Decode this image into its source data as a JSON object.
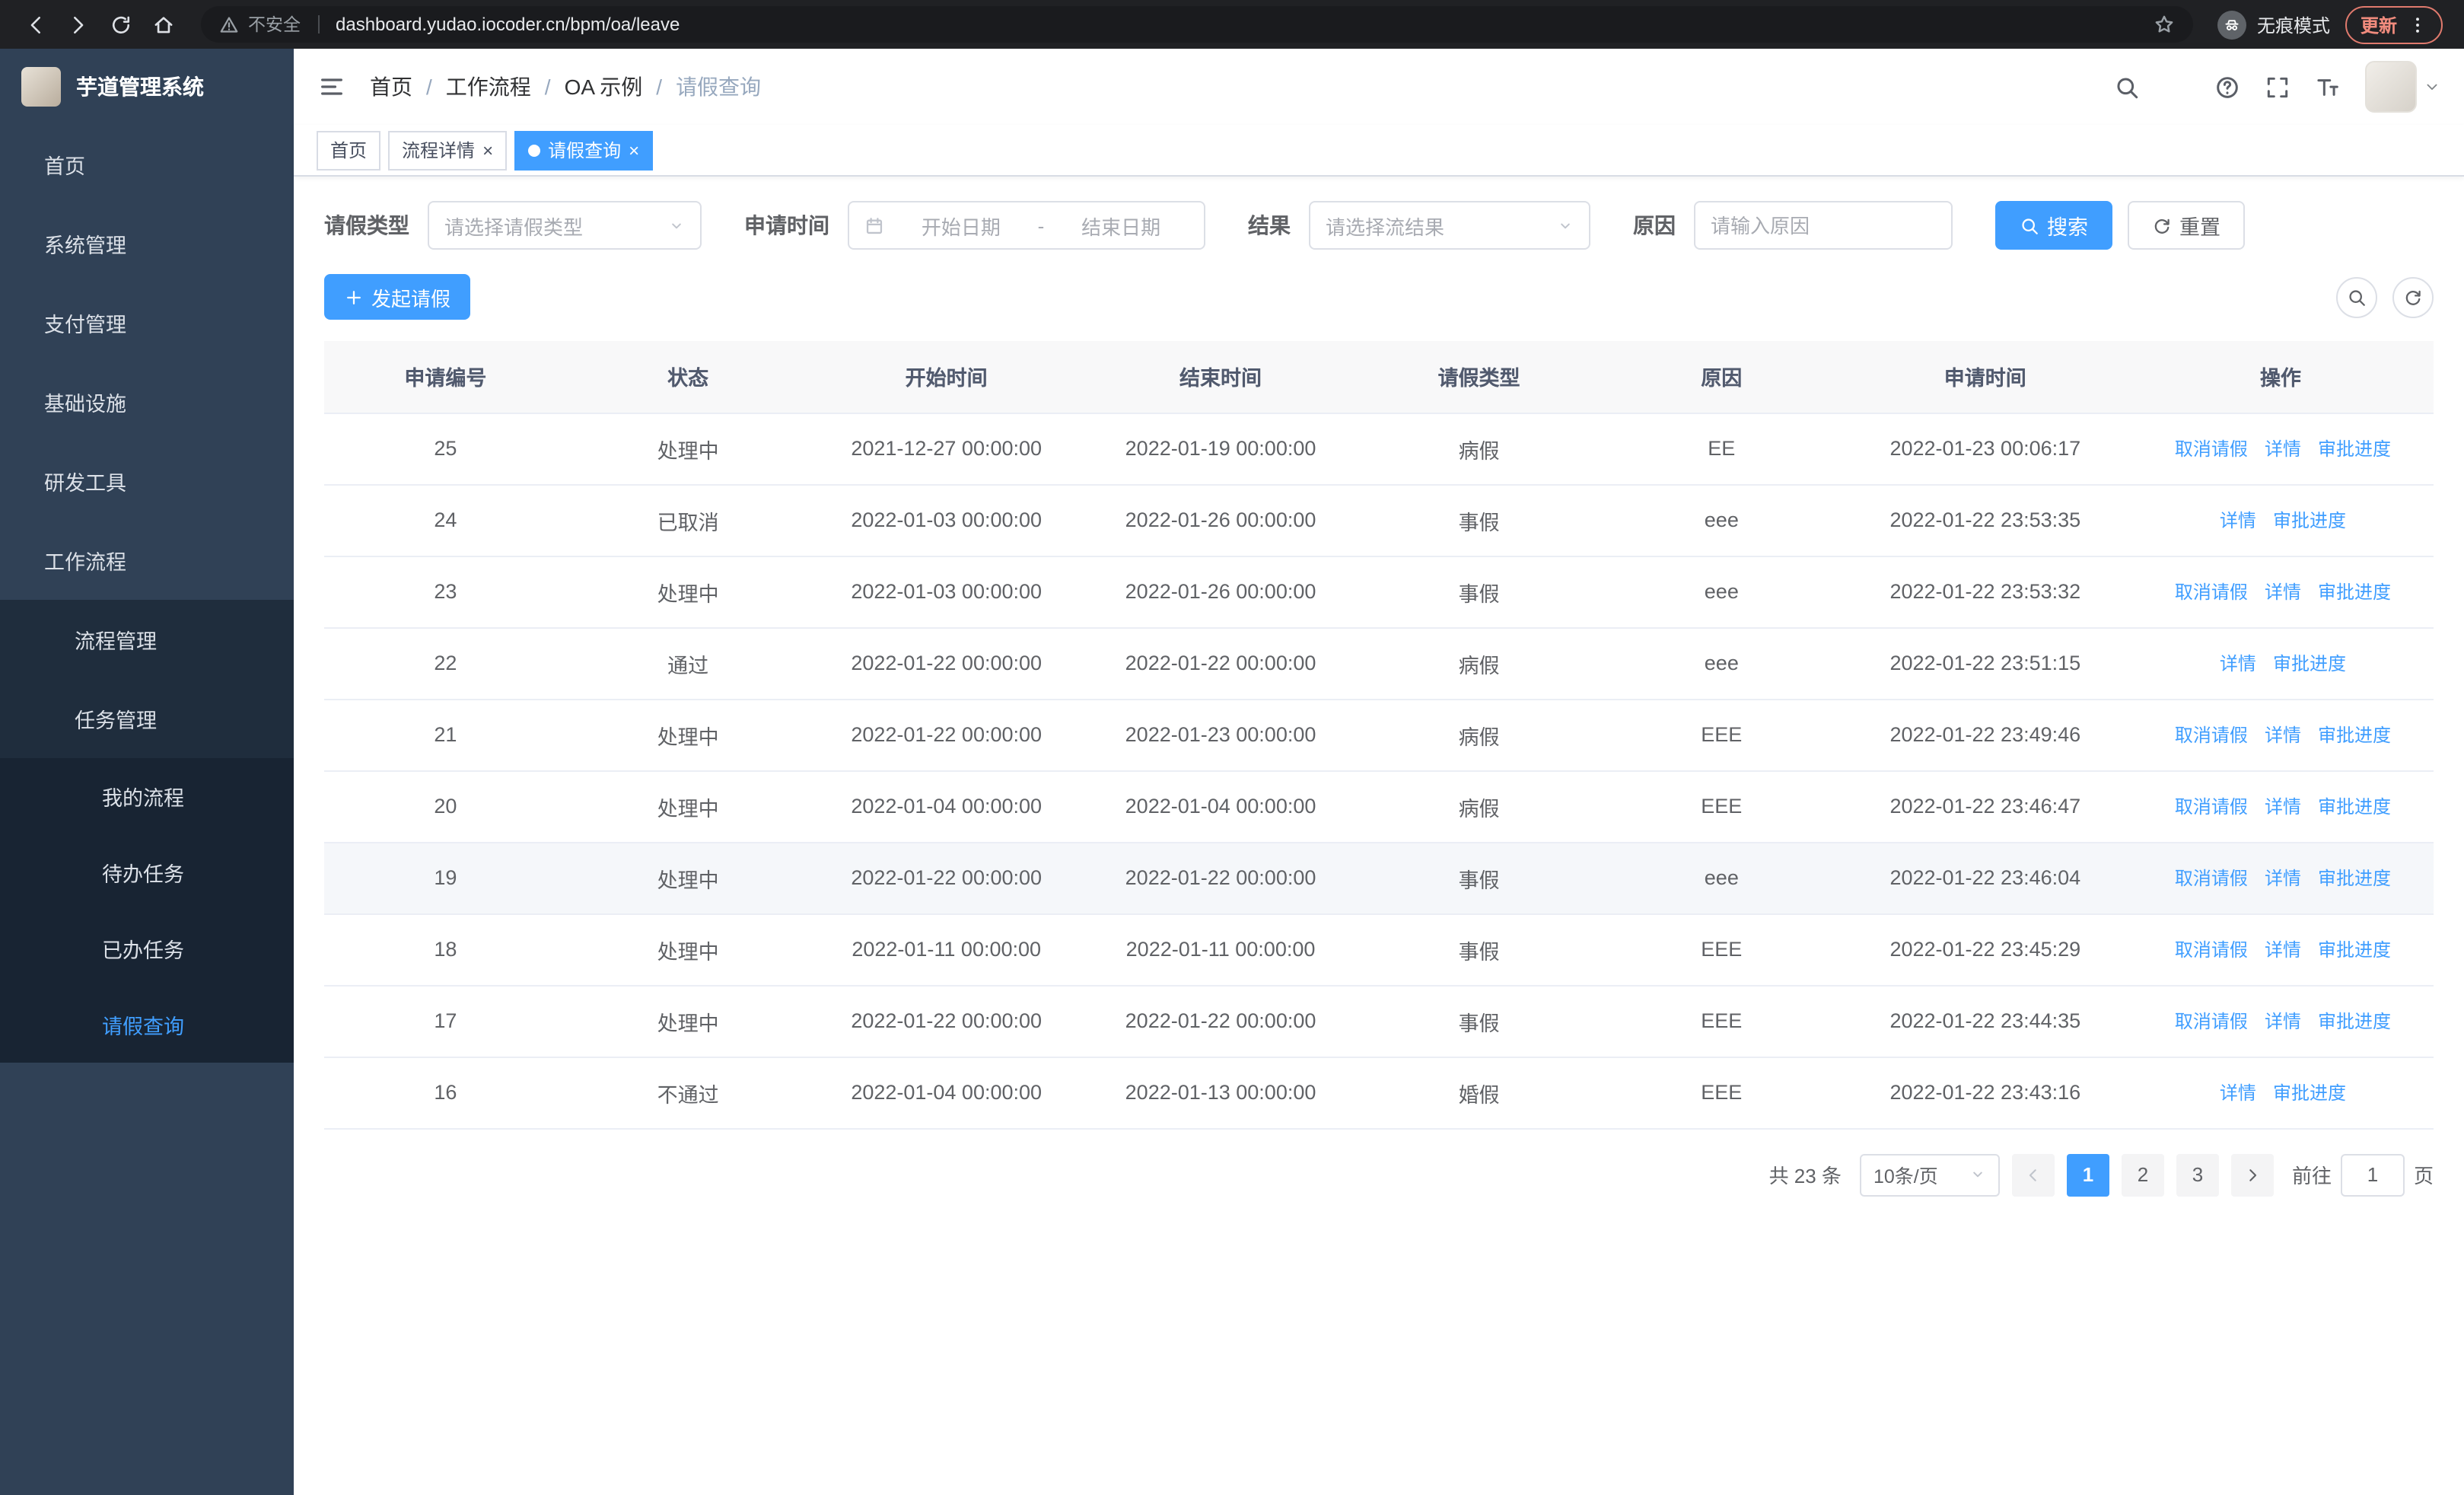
{
  "browser": {
    "security_label": "不安全",
    "url": "dashboard.yudao.iocoder.cn/bpm/oa/leave",
    "incognito_label": "无痕模式",
    "update_label": "更新"
  },
  "app": {
    "title": "芋道管理系统"
  },
  "colors": {
    "accent": "#409eff",
    "sidebar_bg": "#304156",
    "sidebar_sub_bg": "#1f2d3d"
  },
  "sidebar": {
    "items": [
      {
        "key": "home",
        "label": "首页",
        "icon": "dashboard-icon",
        "level": "top"
      },
      {
        "key": "system",
        "label": "系统管理",
        "icon": "gear-icon",
        "level": "top",
        "arrow": "down"
      },
      {
        "key": "payment",
        "label": "支付管理",
        "icon": "payment-icon",
        "level": "top",
        "arrow": "down"
      },
      {
        "key": "infra",
        "label": "基础设施",
        "icon": "infra-icon",
        "level": "top",
        "arrow": "down"
      },
      {
        "key": "devtools",
        "label": "研发工具",
        "icon": "devtools-icon",
        "level": "top",
        "arrow": "down"
      },
      {
        "key": "workflow",
        "label": "工作流程",
        "icon": "workflow-icon",
        "level": "top",
        "arrow": "up"
      },
      {
        "key": "process-manage",
        "label": "流程管理",
        "icon": "process-icon",
        "level": "sub",
        "arrow": "down"
      },
      {
        "key": "task-manage",
        "label": "任务管理",
        "icon": "task-icon",
        "level": "sub",
        "arrow": "up"
      },
      {
        "key": "my-process",
        "label": "我的流程",
        "icon": "my-process-icon",
        "level": "sub2"
      },
      {
        "key": "todo-task",
        "label": "待办任务",
        "icon": "todo-icon",
        "level": "sub2"
      },
      {
        "key": "done-task",
        "label": "已办任务",
        "icon": "done-icon",
        "level": "sub2"
      },
      {
        "key": "leave-query",
        "label": "请假查询",
        "icon": "user-icon",
        "level": "sub2",
        "active": true
      }
    ]
  },
  "breadcrumb": {
    "items": [
      "首页",
      "工作流程",
      "OA 示例",
      "请假查询"
    ]
  },
  "tabs": [
    {
      "key": "home",
      "label": "首页",
      "closable": false,
      "active": false
    },
    {
      "key": "process-detail",
      "label": "流程详情",
      "closable": true,
      "active": false
    },
    {
      "key": "leave-query",
      "label": "请假查询",
      "closable": true,
      "active": true
    }
  ],
  "filters": {
    "type_label": "请假类型",
    "type_placeholder": "请选择请假类型",
    "time_label": "申请时间",
    "start_placeholder": "开始日期",
    "range_separator": "-",
    "end_placeholder": "结束日期",
    "result_label": "结果",
    "result_placeholder": "请选择流结果",
    "reason_label": "原因",
    "reason_placeholder": "请输入原因",
    "search_label": "搜索",
    "reset_label": "重置"
  },
  "toolbar": {
    "create_label": "发起请假"
  },
  "table": {
    "columns": [
      "申请编号",
      "状态",
      "开始时间",
      "结束时间",
      "请假类型",
      "原因",
      "申请时间",
      "操作"
    ],
    "ops_labels": {
      "cancel": "取消请假",
      "detail": "详情",
      "progress": "审批进度"
    },
    "rows": [
      {
        "id": "25",
        "status": "处理中",
        "start": "2021-12-27 00:00:00",
        "end": "2022-01-19 00:00:00",
        "type": "病假",
        "reason": "EE",
        "apply_time": "2022-01-23 00:06:17",
        "ops": [
          "cancel",
          "detail",
          "progress"
        ],
        "highlight": false
      },
      {
        "id": "24",
        "status": "已取消",
        "start": "2022-01-03 00:00:00",
        "end": "2022-01-26 00:00:00",
        "type": "事假",
        "reason": "eee",
        "apply_time": "2022-01-22 23:53:35",
        "ops": [
          "detail",
          "progress"
        ],
        "highlight": false
      },
      {
        "id": "23",
        "status": "处理中",
        "start": "2022-01-03 00:00:00",
        "end": "2022-01-26 00:00:00",
        "type": "事假",
        "reason": "eee",
        "apply_time": "2022-01-22 23:53:32",
        "ops": [
          "cancel",
          "detail",
          "progress"
        ],
        "highlight": false
      },
      {
        "id": "22",
        "status": "通过",
        "start": "2022-01-22 00:00:00",
        "end": "2022-01-22 00:00:00",
        "type": "病假",
        "reason": "eee",
        "apply_time": "2022-01-22 23:51:15",
        "ops": [
          "detail",
          "progress"
        ],
        "highlight": false
      },
      {
        "id": "21",
        "status": "处理中",
        "start": "2022-01-22 00:00:00",
        "end": "2022-01-23 00:00:00",
        "type": "病假",
        "reason": "EEE",
        "apply_time": "2022-01-22 23:49:46",
        "ops": [
          "cancel",
          "detail",
          "progress"
        ],
        "highlight": false
      },
      {
        "id": "20",
        "status": "处理中",
        "start": "2022-01-04 00:00:00",
        "end": "2022-01-04 00:00:00",
        "type": "病假",
        "reason": "EEE",
        "apply_time": "2022-01-22 23:46:47",
        "ops": [
          "cancel",
          "detail",
          "progress"
        ],
        "highlight": false
      },
      {
        "id": "19",
        "status": "处理中",
        "start": "2022-01-22 00:00:00",
        "end": "2022-01-22 00:00:00",
        "type": "事假",
        "reason": "eee",
        "apply_time": "2022-01-22 23:46:04",
        "ops": [
          "cancel",
          "detail",
          "progress"
        ],
        "highlight": true
      },
      {
        "id": "18",
        "status": "处理中",
        "start": "2022-01-11 00:00:00",
        "end": "2022-01-11 00:00:00",
        "type": "事假",
        "reason": "EEE",
        "apply_time": "2022-01-22 23:45:29",
        "ops": [
          "cancel",
          "detail",
          "progress"
        ],
        "highlight": false
      },
      {
        "id": "17",
        "status": "处理中",
        "start": "2022-01-22 00:00:00",
        "end": "2022-01-22 00:00:00",
        "type": "事假",
        "reason": "EEE",
        "apply_time": "2022-01-22 23:44:35",
        "ops": [
          "cancel",
          "detail",
          "progress"
        ],
        "highlight": false
      },
      {
        "id": "16",
        "status": "不通过",
        "start": "2022-01-04 00:00:00",
        "end": "2022-01-13 00:00:00",
        "type": "婚假",
        "reason": "EEE",
        "apply_time": "2022-01-22 23:43:16",
        "ops": [
          "detail",
          "progress"
        ],
        "highlight": false
      }
    ]
  },
  "pagination": {
    "total_label": "共 23 条",
    "page_size": "10条/页",
    "pages": [
      "1",
      "2",
      "3"
    ],
    "active_page": "1",
    "goto_label": "前往",
    "goto_value": "1",
    "page_unit": "页"
  }
}
